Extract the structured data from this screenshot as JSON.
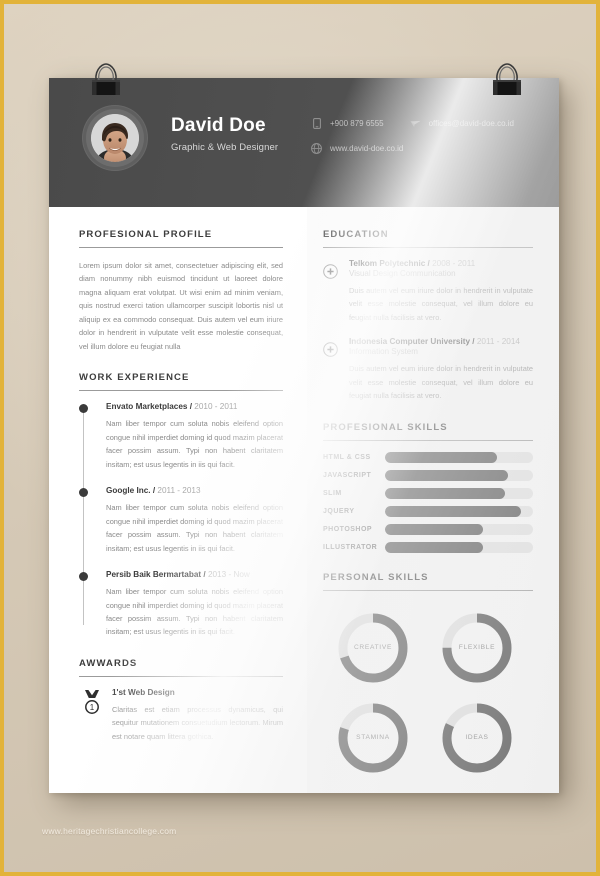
{
  "theme": {
    "frame_color": "#e2b33a",
    "board_color": "#d2c6b2",
    "header_bg": "#4b4b4b",
    "accent_dark": "#4b4b4b",
    "track_gray": "#e0e0e0",
    "muted_text": "#8a8a8a"
  },
  "header": {
    "name": "David Doe",
    "role": "Graphic & Web Designer",
    "contacts": {
      "phone": "+900 879 6555",
      "email": "offices@david-doe.co.id",
      "website": "www.david-doe.co.id",
      "phone_icon": "phone-icon",
      "email_icon": "mail-icon",
      "web_icon": "globe-icon"
    },
    "avatar_icon": "avatar-portrait"
  },
  "profile": {
    "title": "Profesional Profile",
    "text": "Lorem ipsum dolor sit amet, consectetuer adipiscing elit, sed diam nonummy nibh euismod tincidunt ut laoreet dolore magna aliquam erat volutpat. Ut wisi enim ad minim veniam, quis nostrud exerci tation ullamcorper suscipit lobortis nisl ut aliquip ex ea commodo consequat. Duis autem vel eum iriure dolor in hendrerit in vulputate velit esse molestie consequat, vel illum dolore eu feugiat nulla"
  },
  "work": {
    "title": "Work Experience",
    "jobs": [
      {
        "company": "Envato Marketplaces /",
        "date": "2010 - 2011",
        "text": "Nam liber tempor cum soluta nobis eleifend option congue nihil imperdiet doming id quod mazim placerat facer possim assum. Typi non habent claritatem insitam; est usus legentis in iis qui facit."
      },
      {
        "company": "Google Inc. /",
        "date": "2011 - 2013",
        "text": "Nam liber tempor cum soluta nobis eleifend option congue nihil imperdiet doming id quod mazim placerat facer possim assum. Typi non habent claritatem insitam; est usus legentis in iis qui facit."
      },
      {
        "company": "Persib Baik Bermartabat /",
        "date": "2013 - Now",
        "text": "Nam liber tempor cum soluta nobis eleifend option congue nihil imperdiet doming id quod mazim placerat facer possim assum. Typi non habent claritatem insitam; est usus legentis in iis qui facit."
      }
    ]
  },
  "awards": {
    "title": "Awwards",
    "icon": "medal-icon",
    "items": [
      {
        "name": "1'st Web Design",
        "text": "Claritas est etiam processus dynamicus, qui sequitur mutationem consuetudium lectorum. Mirum est notare quam littera gothica."
      }
    ]
  },
  "education": {
    "title": "Education",
    "item_icon": "plus-circle-icon",
    "items": [
      {
        "school": "Telkom Polytechnic /",
        "date": "2008 - 2011",
        "program": "Visual Design Communication",
        "text": "Duis autem vel eum iriure dolor in hendrerit in vulputate velit esse molestie consequat, vel illum dolore eu feugiat nulla facilisis at vero."
      },
      {
        "school": "Indonesia Computer University /",
        "date": "2011 - 2014",
        "program": "Information System",
        "text": "Duis autem vel eum iriure dolor in hendrerit in vulputate velit esse molestie consequat, vel illum dolore eu feugiat nulla facilisis at vero."
      }
    ]
  },
  "professional_skills": {
    "title": "Profesional Skills",
    "skills": [
      {
        "label": "HTML & CSS",
        "percent": 76
      },
      {
        "label": "JAVASCRIPT",
        "percent": 83
      },
      {
        "label": "SLIM",
        "percent": 81
      },
      {
        "label": "JQUERY",
        "percent": 92
      },
      {
        "label": "PHOTOSHOP",
        "percent": 66
      },
      {
        "label": "ILLUSTRATOR",
        "percent": 66
      }
    ]
  },
  "personal_skills": {
    "title": "Personal Skills",
    "skills": [
      {
        "label": "CREATIVE",
        "percent": 70
      },
      {
        "label": "FLEXIBLE",
        "percent": 75
      },
      {
        "label": "STAMINA",
        "percent": 80
      },
      {
        "label": "IDEAS",
        "percent": 82
      }
    ]
  },
  "decor": {
    "clip_left_icon": "binder-clip-icon",
    "clip_right_icon": "binder-clip-icon"
  },
  "watermark": "www.heritagechristiancollege.com"
}
